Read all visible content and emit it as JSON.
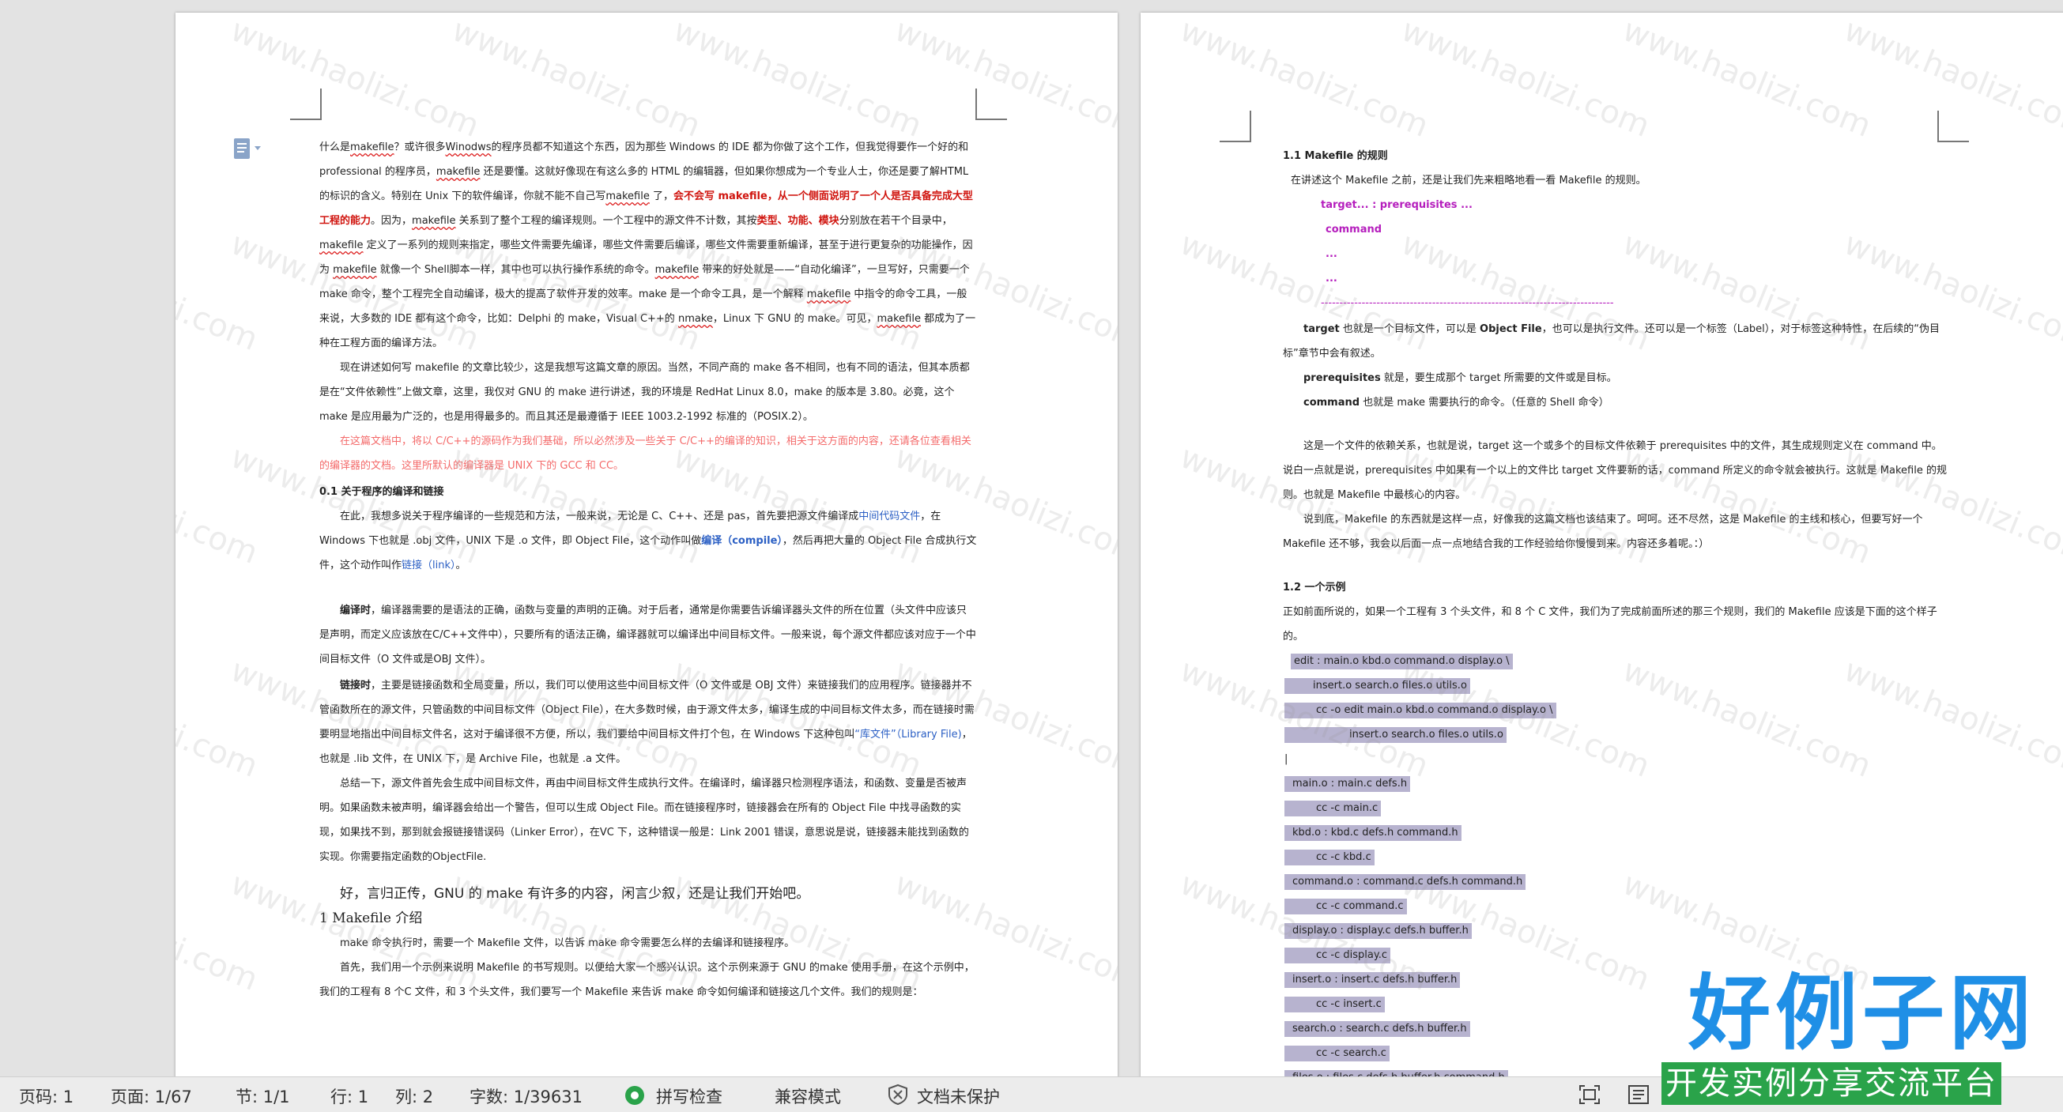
{
  "watermark": "www.haolizi.com",
  "left_page": {
    "p1": [
      "什么是",
      "makefile",
      "？或许很多",
      "Winodws",
      "的程序员都不知道这个东西，因为那些 Windows 的 IDE 都为你做了这个工作，但我觉得要作一个好的和professional 的程序员，",
      "makefile",
      " 还是要懂。这就好像现在有这么多的 HTML 的编辑器，但如果你想成为一个专业人士，你还是要了解HTML 的标识的含义。特别在 Unix 下的软件编译，你就不能不自己写",
      "makefile",
      " 了，",
      "会不会写 makefile，从一个侧面说明了一个人是否具备完成大型工程的能力",
      "。因为，",
      "makefile",
      " 关系到了整个工程的编译规则。一个工程中的源文件不计数，其按",
      "类型、功能、模块",
      "分别放在若干个目录中，",
      "makefile",
      " 定义了一系列的规则来指定，哪些文件需要先编译，哪些文件需要后编译，哪些文件需要重新编译，甚至于进行更复杂的功能操作，因为 ",
      "makefile",
      " 就像一个 Shell脚本一样，其中也可以执行操作系统的命令。",
      "makefile",
      " 带来的好处就是——“自动化编译”，一旦写好，只需要一个 make 命令，整个工程完全自动编译，极大的提高了软件开发的效率。make 是一个命令工具，是一个解释 ",
      "makefile",
      " 中指令的命令工具，一般来说，大多数的 IDE 都有这个命令，比如：Delphi 的 make，Visual C++的 ",
      "nmake",
      "，Linux 下 GNU 的 make。可见，",
      "makefile",
      " 都成为了一种在工程方面的编译方法。"
    ],
    "p2": "现在讲述如何写 makefile 的文章比较少，这是我想写这篇文章的原因。当然，不同产商的 make 各不相同，也有不同的语法，但其本质都是在“文件依赖性”上做文章，这里，我仅对 GNU 的 make 进行讲述，我的环境是 RedHat Linux 8.0，make 的版本是 3.80。必竟，这个 make 是应用最为广泛的，也是用得最多的。而且其还是最遵循于 IEEE 1003.2-1992 标准的（POSIX.2）。",
    "p3": "在这篇文档中，将以 C/C++的源码作为我们基础，所以必然涉及一些关于 C/C++的编译的知识，相关于这方面的内容，还请各位查看相关的编译器的文档。这里所默认的编译器是 UNIX 下的 GCC 和 CC。",
    "h01": "0.1 关于程序的编译和链接",
    "p4a": "在此，我想多说关于程序编译的一些规范和方法，一般来说，无论是 C、C++、还是 pas，首先要把源文件编译成",
    "p4b": "中间代码文件",
    "p4c": "，在 Windows 下也就是 .obj 文件，UNIX 下是 .o 文件，即 Object File，这个动作叫做",
    "p4d": "编译（compile）",
    "p4e": "，然后再把大量的 Object File 合成执行文件，这个动作叫作",
    "p4f": "链接（link）",
    "p4g": "。",
    "p5a": "编译时",
    "p5b": "，编译器需要的是语法的正确，函数与变量的声明的正确。对于后者，通常是你需要告诉编译器头文件的所在位置（头文件中应该只是声明，而定义应该放在C/C++文件中），只要所有的语法正确，编译器就可以编译出中间目标文件。一般来说，每个源文件都应该对应于一个中间目标文件（O 文件或是OBJ 文件）。",
    "p6a": "链接时",
    "p6b": "，主要是链接函数和全局变量，所以，我们可以使用这些中间目标文件（O 文件或是 OBJ 文件）来链接我们的应用程序。链接器并不管函数所在的源文件，只管函数的中间目标文件（Object File），在大多数时候，由于源文件太多，编译生成的中间目标文件太多，而在链接时需要明显地指出中间目标文件名，这对于编译很不方便，所以，我们要给中间目标文件打个包，在 Windows 下这种包叫",
    "p6c": "“库文件”（Library File)",
    "p6d": "，也就是 .lib 文件，在 UNIX 下，是 Archive File，也就是 .a 文件。",
    "p7": "总结一下，源文件首先会生成中间目标文件，再由中间目标文件生成执行文件。在编译时，编译器只检测程序语法，和函数、变量是否被声明。如果函数未被声明，编译器会给出一个警告，但可以生成 Object File。而在链接程序时，链接器会在所有的 Object File 中找寻函数的实现，如果找不到，那到就会报链接错误码（Linker Error），在VC 下，这种错误一般是：Link 2001 错误，意思说是说，链接器未能找到函数的实现。你需要指定函数的ObjectFile.",
    "p8": "好，言归正传，GNU 的 make 有许多的内容，闲言少叙，还是让我们开始吧。",
    "h1": "1 Makefile 介绍",
    "p9": "make 命令执行时，需要一个 Makefile 文件，以告诉 make 命令需要怎么样的去编译和链接程序。",
    "p10": "首先，我们用一个示例来说明 Makefile 的书写规则。以便给大家一个感兴认识。这个示例来源于 GNU 的make 使用手册，在这个示例中，我们的工程有 8 个C 文件，和 3 个头文件，我们要写一个 Makefile 来告诉 make 命令如何编译和链接这几个文件。我们的规则是：",
    "side_tool_label": "文档视图工具"
  },
  "right_page": {
    "h11": "1.1 Makefile 的规则",
    "p1": "在讲述这个 Makefile 之前，还是让我们先来粗略地看一看 Makefile 的规则。",
    "rule": [
      "target... : prerequisites ...",
      "command",
      "...",
      "..."
    ],
    "dash_line": "-------------------------------------------------------------------------------------------------------",
    "p2a": "target",
    "p2b": " 也就是一个目标文件，可以是 ",
    "p2c": "Object File",
    "p2d": "，也可以是执行文件。还可以是一个标签（Label），对于标签这种特性，在后续的“伪目标”章节中会有叙述。",
    "p3a": "prerequisites",
    "p3b": " 就是，要生成那个 target 所需要的文件或是目标。",
    "p4a": "command",
    "p4b": " 也就是 make 需要执行的命令。（任意的 Shell 命令）",
    "p5": "这是一个文件的依赖关系，也就是说，target 这一个或多个的目标文件依赖于 prerequisites 中的文件，其生成规则定义在 command 中。说白一点就是说，prerequisites 中如果有一个以上的文件比 target 文件要新的话，command 所定义的命令就会被执行。这就是 Makefile 的规则。也就是 Makefile 中最核心的内容。",
    "p6": "说到底，Makefile 的东西就是这样一点，好像我的这篇文档也该结束了。呵呵。还不尽然，这是 Makefile 的主线和核心，但要写好一个 Makefile 还不够，我会以后面一点一点地结合我的工作经验给你慢慢到来。内容还多着呢。：）",
    "h12": "1.2 一个示例",
    "p7": "正如前面所说的，如果一个工程有 3 个头文件，和 8 个 C 文件，我们为了完成前面所述的那三个规则，我们的 Makefile 应该是下面的这个样子的。",
    "code": [
      "edit : main.o kbd.o command.o display.o \\",
      "insert.o search.o files.o utils.o",
      "cc -o edit main.o kbd.o command.o display.o \\",
      "insert.o search.o files.o utils.o",
      "",
      "main.o : main.c defs.h",
      "cc -c main.c",
      "kbd.o : kbd.c defs.h command.h",
      "cc -c kbd.c",
      "command.o : command.c defs.h command.h",
      "cc -c command.c",
      "display.o : display.c defs.h buffer.h",
      "cc -c display.c",
      "insert.o : insert.c defs.h buffer.h",
      "cc -c insert.c",
      "search.o : search.c defs.h buffer.h",
      "cc -c search.c",
      "files.o : files.c defs.h buffer.h command.h"
    ]
  },
  "statusbar": {
    "page_code": "页码: 1",
    "page": "页面: 1/67",
    "section": "节: 1/1",
    "row": "行: 1",
    "col": "列: 2",
    "words": "字数: 1/39631",
    "spell": "拼写检查",
    "compat": "兼容模式",
    "protect": "文档未保护"
  },
  "logo": {
    "title": "好例子网",
    "subtitle": "开发实例分享交流平台"
  },
  "colors": {
    "accent_red": "#d0140e",
    "link_blue": "#2b5fc4",
    "logo_blue": "#1f8fe6",
    "logo_green": "#2aa34a",
    "code_highlight": "#b7b3cf"
  }
}
